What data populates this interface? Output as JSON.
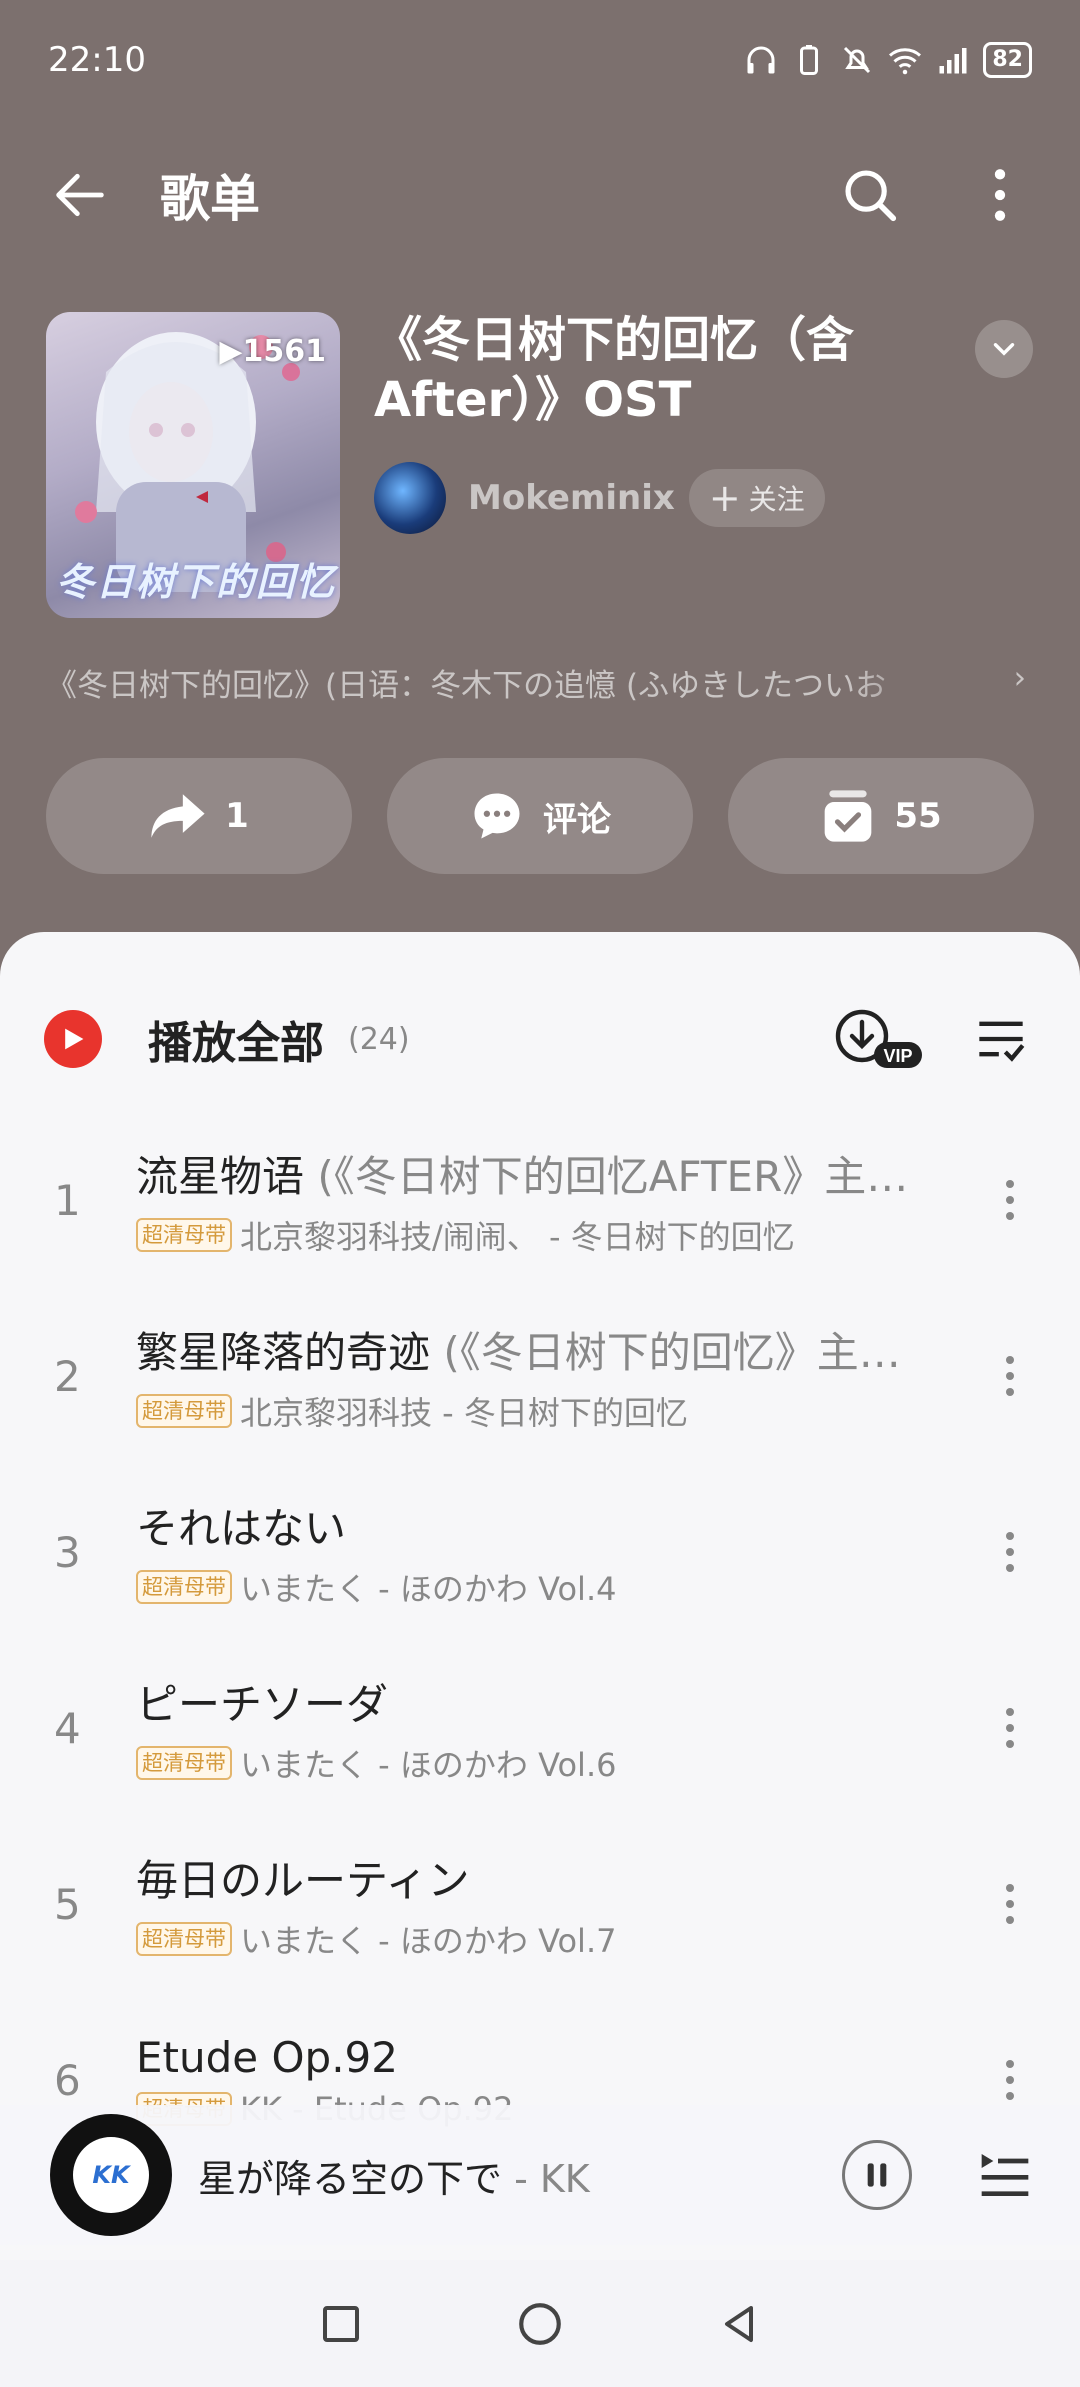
{
  "status": {
    "time": "22:10",
    "battery": "82",
    "network": "4G"
  },
  "app_bar": {
    "title": "歌单"
  },
  "playlist": {
    "title": "《冬日树下的回忆（含After）》OST",
    "play_count": "▶1561",
    "cover_caption": "冬日树下的回忆",
    "creator": "Mokeminix",
    "follow_label": "关注",
    "description": "《冬日树下的回忆》(日语：冬木下の追憶 (ふゆきしたついお",
    "actions": {
      "share": "1",
      "comment": "评论",
      "collect": "55"
    }
  },
  "list": {
    "play_all_label": "播放全部",
    "count": "(24)",
    "quality_badge": "超清母带",
    "songs": [
      {
        "index": "1",
        "title": "流星物语",
        "subtitle": " (《冬日树下的回忆AFTER》主…",
        "meta": "北京黎羽科技/闹闹、 - 冬日树下的回忆"
      },
      {
        "index": "2",
        "title": "繁星降落的奇迹",
        "subtitle": " (《冬日树下的回忆》主…",
        "meta": "北京黎羽科技 - 冬日树下的回忆"
      },
      {
        "index": "3",
        "title": "それはない",
        "subtitle": "",
        "meta": "いまたく - ほのかわ Vol.4"
      },
      {
        "index": "4",
        "title": "ピーチソーダ",
        "subtitle": "",
        "meta": "いまたく - ほのかわ Vol.6"
      },
      {
        "index": "5",
        "title": "毎日のルーティン",
        "subtitle": "",
        "meta": "いまたく - ほのかわ Vol.7"
      },
      {
        "index": "6",
        "title": "Etude Op.92",
        "subtitle": "",
        "meta": "KK - Etude Op.92"
      }
    ]
  },
  "now_playing": {
    "title": "星が降る空の下で",
    "artist": " - KK",
    "disc_label": "KK"
  },
  "colors": {
    "header_bg": "#7c706e",
    "accent_red": "#e8342d",
    "badge_gold": "#d49a3c"
  }
}
